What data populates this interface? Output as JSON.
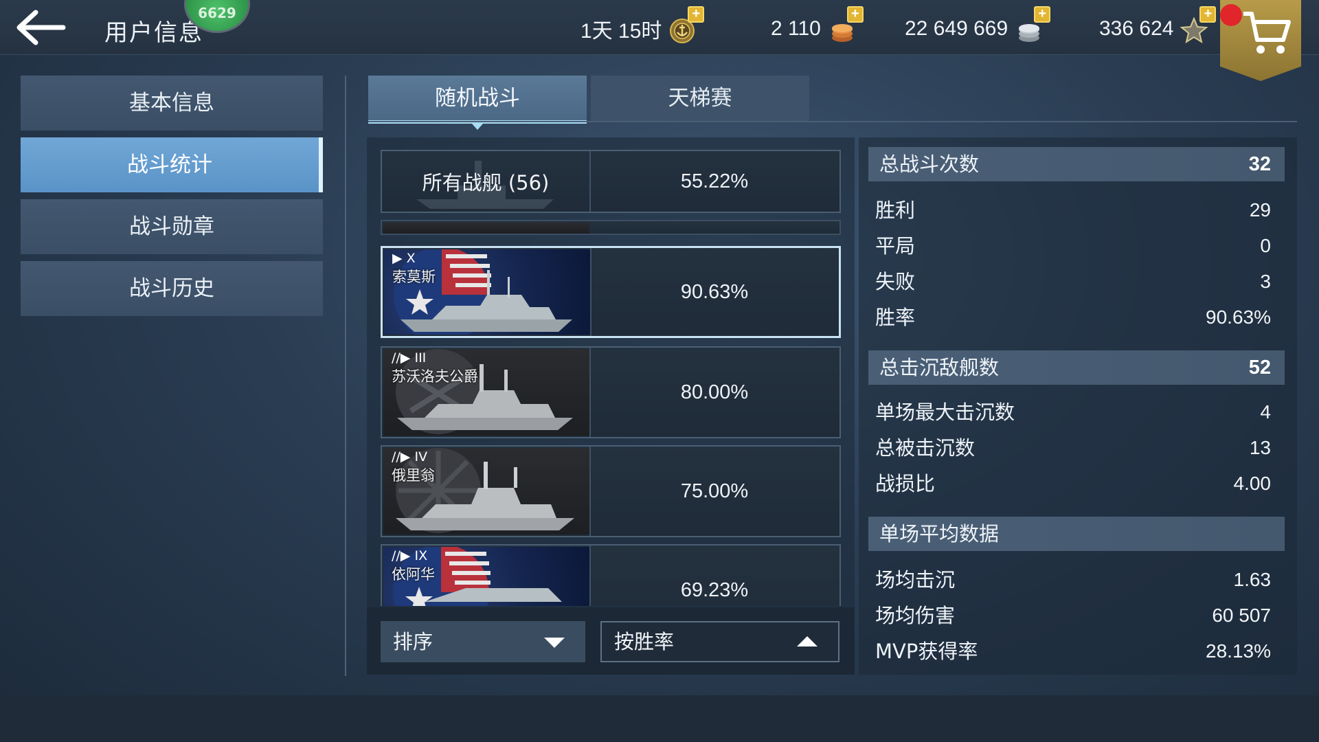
{
  "header": {
    "title": "用户信息",
    "level": "6629",
    "resources": {
      "time": "1天 15时",
      "coins": "2 110",
      "silver": "22 649 669",
      "stars": "336 624"
    }
  },
  "sidebar": {
    "items": [
      {
        "label": "基本信息"
      },
      {
        "label": "战斗统计"
      },
      {
        "label": "战斗勋章"
      },
      {
        "label": "战斗历史"
      }
    ],
    "active_index": 1
  },
  "tabs": [
    {
      "label": "随机战斗"
    },
    {
      "label": "天梯赛"
    }
  ],
  "ship_list": {
    "all_ships": {
      "label": "所有战舰 (56)",
      "rate": "55.22%"
    },
    "ships": [
      {
        "tier": "X",
        "name": "索莫斯",
        "rate": "90.63%",
        "nation": "us"
      },
      {
        "tier": "III",
        "name": "苏沃洛夫公爵",
        "rate": "80.00%",
        "nation": "ru"
      },
      {
        "tier": "IV",
        "name": "俄里翁",
        "rate": "75.00%",
        "nation": "ru"
      },
      {
        "tier": "IX",
        "name": "依阿华",
        "rate": "69.23%",
        "nation": "us"
      }
    ]
  },
  "sort": {
    "label": "排序",
    "value": "按胜率"
  },
  "stats": {
    "total_battles": {
      "label": "总战斗次数",
      "value": "32"
    },
    "battle_rows": [
      {
        "label": "胜利",
        "value": "29"
      },
      {
        "label": "平局",
        "value": "0"
      },
      {
        "label": "失败",
        "value": "3"
      },
      {
        "label": "胜率",
        "value": "90.63%"
      }
    ],
    "total_kills": {
      "label": "总击沉敌舰数",
      "value": "52"
    },
    "kill_rows": [
      {
        "label": "单场最大击沉数",
        "value": "4"
      },
      {
        "label": "总被击沉数",
        "value": "13"
      },
      {
        "label": "战损比",
        "value": "4.00"
      }
    ],
    "avg_header": {
      "label": "单场平均数据"
    },
    "avg_rows": [
      {
        "label": "场均击沉",
        "value": "1.63"
      },
      {
        "label": "场均伤害",
        "value": "60 507"
      },
      {
        "label": "MVP获得率",
        "value": "28.13%"
      }
    ]
  },
  "colors": {
    "accent_tab": "#a9dcf5",
    "active_menu": "#5a93c7",
    "shop": "#a38840",
    "plus": "#e2b632",
    "alert_dot": "#e0262a"
  },
  "icons": [
    "back-arrow-icon",
    "anchor-medal-icon",
    "gold-coin-icon",
    "silver-coin-icon",
    "star-icon",
    "cart-icon",
    "plus-icon",
    "chevron-down-icon",
    "chevron-up-icon"
  ]
}
